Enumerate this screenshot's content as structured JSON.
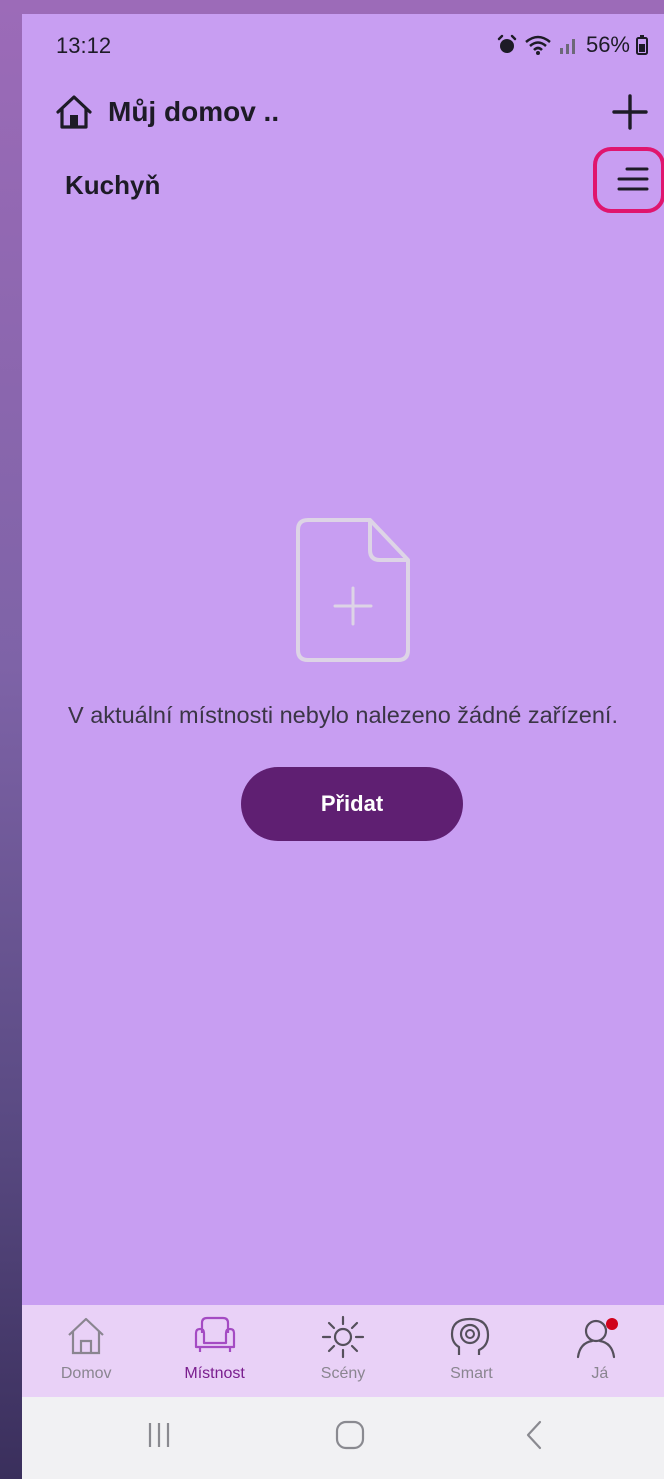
{
  "status_bar": {
    "time": "13:12",
    "battery": "56%",
    "icons": [
      "alarm-icon",
      "wifi-icon",
      "signal-icon",
      "battery-icon"
    ]
  },
  "header": {
    "home_title": "Můj domov ..",
    "home_icon": "home-icon",
    "add_icon": "plus-icon"
  },
  "room": {
    "title": "Kuchyň",
    "menu_icon": "menu-icon"
  },
  "empty_state": {
    "icon": "add-document-icon",
    "message": "V aktuální místnosti nebylo nalezeno žádné zařízení.",
    "add_button_label": "Přidat"
  },
  "bottom_nav": {
    "items": [
      {
        "label": "Domov",
        "icon": "house-icon",
        "active": false
      },
      {
        "label": "Místnost",
        "icon": "armchair-icon",
        "active": true
      },
      {
        "label": "Scény",
        "icon": "sun-icon",
        "active": false
      },
      {
        "label": "Smart",
        "icon": "brain-gear-icon",
        "active": false
      },
      {
        "label": "Já",
        "icon": "user-icon",
        "active": false
      }
    ]
  },
  "colors": {
    "background": "#c89ef2",
    "accent": "#5f1f72",
    "active_nav": "#7a1e8e",
    "highlight": "#e0156e",
    "notification_dot": "#d0021b"
  }
}
